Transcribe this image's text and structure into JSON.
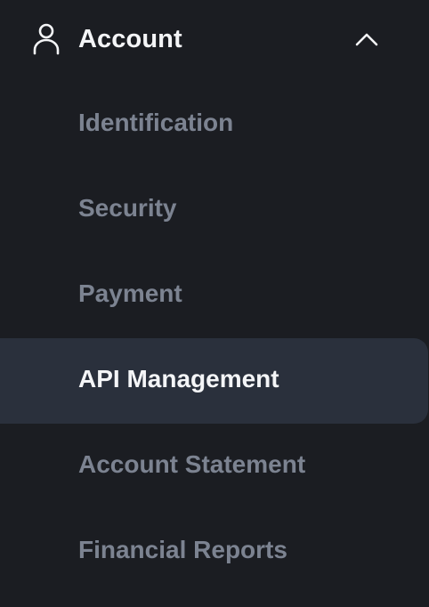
{
  "section": {
    "title": "Account",
    "icon": "user-icon",
    "toggle_icon": "chevron-up-icon",
    "expanded": true
  },
  "nav": {
    "items": [
      {
        "label": "Identification",
        "active": false
      },
      {
        "label": "Security",
        "active": false
      },
      {
        "label": "Payment",
        "active": false
      },
      {
        "label": "API Management",
        "active": true
      },
      {
        "label": "Account Statement",
        "active": false
      },
      {
        "label": "Financial Reports",
        "active": false
      }
    ]
  },
  "colors": {
    "background": "#1b1d22",
    "active_background": "#2a303c",
    "text_primary": "#f4f5f7",
    "text_muted": "#7c8391"
  }
}
